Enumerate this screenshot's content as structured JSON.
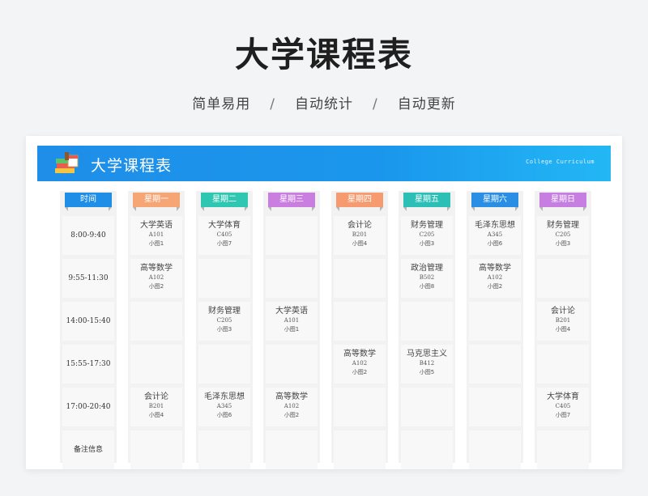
{
  "hero": {
    "title": "大学课程表"
  },
  "subtitle": {
    "items": [
      "简单易用",
      "自动统计",
      "自动更新"
    ],
    "separator": "/"
  },
  "banner": {
    "title": "大学课程表",
    "english": "College Curriculum"
  },
  "colors": {
    "time": "#1e8ee6",
    "mon": "#f6a574",
    "tue": "#2fc7b2",
    "wed": "#c97ee0",
    "thu": "#f59b6f",
    "fri": "#2bbfb5",
    "sat": "#2a8fe4",
    "sun": "#c67fe0"
  },
  "headers": [
    "时间",
    "星期一",
    "星期二",
    "星期三",
    "星期四",
    "星期五",
    "星期六",
    "星期日"
  ],
  "times": [
    "8:00-9:40",
    "9:55-11:30",
    "14:00-15:40",
    "15:55-17:30",
    "17:00-20:40",
    "备注信息"
  ],
  "schedule": [
    [
      {
        "course": "大学英语",
        "room": "A101",
        "cls": "小图1"
      },
      {
        "course": "高等数学",
        "room": "A102",
        "cls": "小图2"
      },
      null,
      null,
      {
        "course": "会计论",
        "room": "B201",
        "cls": "小图4"
      },
      null
    ],
    [
      {
        "course": "大学体育",
        "room": "C405",
        "cls": "小图7"
      },
      null,
      {
        "course": "财务管理",
        "room": "C205",
        "cls": "小图3"
      },
      null,
      {
        "course": "毛泽东思想",
        "room": "A345",
        "cls": "小图6"
      },
      null
    ],
    [
      null,
      null,
      {
        "course": "大学英语",
        "room": "A101",
        "cls": "小图1"
      },
      null,
      {
        "course": "高等数学",
        "room": "A102",
        "cls": "小图2"
      },
      null
    ],
    [
      {
        "course": "会计论",
        "room": "B201",
        "cls": "小图4"
      },
      null,
      null,
      {
        "course": "高等数学",
        "room": "A102",
        "cls": "小图2"
      },
      null,
      null
    ],
    [
      {
        "course": "财务管理",
        "room": "C205",
        "cls": "小图3"
      },
      {
        "course": "政治管理",
        "room": "B502",
        "cls": "小图8"
      },
      null,
      {
        "course": "马克思主义",
        "room": "B412",
        "cls": "小图5"
      },
      null,
      null
    ],
    [
      {
        "course": "毛泽东思想",
        "room": "A345",
        "cls": "小图6"
      },
      {
        "course": "高等数学",
        "room": "A102",
        "cls": "小图2"
      },
      null,
      null,
      null,
      null
    ],
    [
      {
        "course": "财务管理",
        "room": "C205",
        "cls": "小图3"
      },
      null,
      {
        "course": "会计论",
        "room": "B201",
        "cls": "小图4"
      },
      null,
      {
        "course": "大学体育",
        "room": "C405",
        "cls": "小图7"
      },
      null
    ]
  ]
}
